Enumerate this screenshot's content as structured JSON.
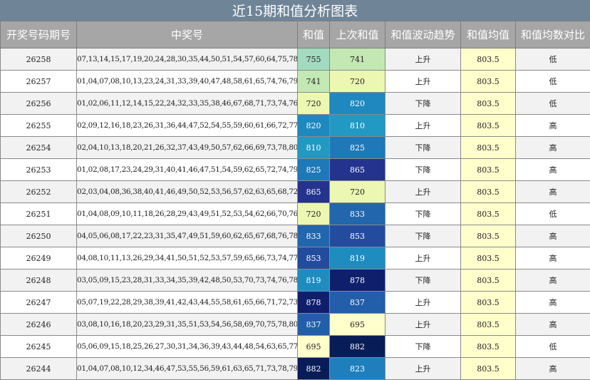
{
  "title": "近15期和值分析图表",
  "headers": [
    "开奖号码期号",
    "中奖号",
    "和值",
    "上次和值",
    "和值波动趋势",
    "和值均值",
    "和值均数对比"
  ],
  "rows": [
    {
      "period": "26258",
      "numbers": "07,13,14,15,17,19,20,24,28,30,35,44,50,51,54,57,60,64,75,78",
      "sum": "755",
      "sum_color": "#a2dbbf",
      "sum_dark": false,
      "prev": "741",
      "prev_color": "#c3e8b4",
      "prev_dark": false,
      "trend": "上升",
      "avg": "803.5",
      "compare": "低"
    },
    {
      "period": "26257",
      "numbers": "01,04,07,08,10,13,23,24,31,33,39,40,47,48,58,61,65,74,76,79",
      "sum": "741",
      "sum_color": "#c3e8b4",
      "sum_dark": false,
      "prev": "720",
      "prev_color": "#ecf7b2",
      "prev_dark": false,
      "trend": "上升",
      "avg": "803.5",
      "compare": "低"
    },
    {
      "period": "26256",
      "numbers": "01,02,06,11,12,14,15,22,24,32,33,35,38,46,67,68,71,73,74,76",
      "sum": "720",
      "sum_color": "#ecf7b2",
      "sum_dark": false,
      "prev": "820",
      "prev_color": "#1e88bf",
      "prev_dark": true,
      "trend": "下降",
      "avg": "803.5",
      "compare": "低"
    },
    {
      "period": "26255",
      "numbers": "02,09,12,16,18,23,26,31,36,44,47,52,54,55,59,60,61,66,72,77",
      "sum": "820",
      "sum_color": "#1e88bf",
      "sum_dark": true,
      "prev": "810",
      "prev_color": "#2199c3",
      "prev_dark": true,
      "trend": "上升",
      "avg": "803.5",
      "compare": "高"
    },
    {
      "period": "26254",
      "numbers": "02,04,10,13,18,20,21,26,32,37,43,49,50,57,62,66,69,73,78,80",
      "sum": "810",
      "sum_color": "#2199c3",
      "sum_dark": true,
      "prev": "825",
      "prev_color": "#1f78b8",
      "prev_dark": true,
      "trend": "下降",
      "avg": "803.5",
      "compare": "高"
    },
    {
      "period": "26253",
      "numbers": "01,02,08,17,23,24,29,31,40,41,46,47,51,54,59,62,65,72,74,79",
      "sum": "825",
      "sum_color": "#1f78b8",
      "sum_dark": true,
      "prev": "865",
      "prev_color": "#24338e",
      "prev_dark": true,
      "trend": "下降",
      "avg": "803.5",
      "compare": "高"
    },
    {
      "period": "26252",
      "numbers": "02,03,04,08,36,38,40,41,46,49,50,52,53,56,57,62,63,65,68,72",
      "sum": "865",
      "sum_color": "#24338e",
      "sum_dark": true,
      "prev": "720",
      "prev_color": "#ecf7b2",
      "prev_dark": false,
      "trend": "上升",
      "avg": "803.5",
      "compare": "高"
    },
    {
      "period": "26251",
      "numbers": "01,04,08,09,10,11,18,26,28,29,43,49,51,52,53,54,62,66,70,76",
      "sum": "720",
      "sum_color": "#ecf7b2",
      "sum_dark": false,
      "prev": "833",
      "prev_color": "#2266ad",
      "prev_dark": true,
      "trend": "下降",
      "avg": "803.5",
      "compare": "低"
    },
    {
      "period": "26250",
      "numbers": "04,05,06,08,17,22,23,31,35,47,49,51,59,60,62,65,67,68,76,78",
      "sum": "833",
      "sum_color": "#2266ad",
      "sum_dark": true,
      "prev": "853",
      "prev_color": "#234c9f",
      "prev_dark": true,
      "trend": "下降",
      "avg": "803.5",
      "compare": "高"
    },
    {
      "period": "26249",
      "numbers": "04,08,10,11,13,26,29,34,41,50,51,52,53,57,59,65,66,73,74,77",
      "sum": "853",
      "sum_color": "#234c9f",
      "sum_dark": true,
      "prev": "819",
      "prev_color": "#1f8cc0",
      "prev_dark": true,
      "trend": "上升",
      "avg": "803.5",
      "compare": "高"
    },
    {
      "period": "26248",
      "numbers": "03,05,09,15,23,28,31,33,34,35,39,42,48,50,53,70,73,74,76,78",
      "sum": "819",
      "sum_color": "#1f8cc0",
      "sum_dark": true,
      "prev": "878",
      "prev_color": "#0f1f6b",
      "prev_dark": true,
      "trend": "下降",
      "avg": "803.5",
      "compare": "高"
    },
    {
      "period": "26247",
      "numbers": "05,07,19,22,28,29,38,39,41,42,43,44,55,58,61,65,66,71,72,73",
      "sum": "878",
      "sum_color": "#0f1f6b",
      "sum_dark": true,
      "prev": "837",
      "prev_color": "#225ea9",
      "prev_dark": true,
      "trend": "上升",
      "avg": "803.5",
      "compare": "高"
    },
    {
      "period": "26246",
      "numbers": "03,08,10,16,18,20,23,29,31,35,51,53,54,56,58,69,70,75,78,80",
      "sum": "837",
      "sum_color": "#225ea9",
      "sum_dark": true,
      "prev": "695",
      "prev_color": "#ffffcc",
      "prev_dark": false,
      "trend": "上升",
      "avg": "803.5",
      "compare": "高"
    },
    {
      "period": "26245",
      "numbers": "05,06,09,15,18,25,26,27,30,31,34,36,39,43,44,48,54,63,65,77",
      "sum": "695",
      "sum_color": "#ffffcc",
      "sum_dark": false,
      "prev": "882",
      "prev_color": "#081d58",
      "prev_dark": true,
      "trend": "下降",
      "avg": "803.5",
      "compare": "低"
    },
    {
      "period": "26244",
      "numbers": "01,04,07,08,10,12,34,46,47,53,55,56,59,61,63,65,71,73,78,79",
      "sum": "882",
      "sum_color": "#081d58",
      "sum_dark": true,
      "prev": "823",
      "prev_color": "#1f7fbc",
      "prev_dark": true,
      "trend": "上升",
      "avg": "803.5",
      "compare": "高"
    }
  ]
}
